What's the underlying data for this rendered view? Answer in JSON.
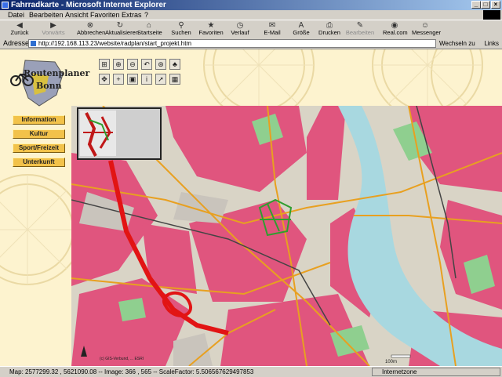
{
  "window": {
    "title": "Fahrradkarte - Microsoft Internet Explorer"
  },
  "menu": [
    "Datei",
    "Bearbeiten",
    "Ansicht",
    "Favoriten",
    "Extras",
    "?"
  ],
  "toolbar": [
    {
      "label": "Zurück",
      "icon": "back-arrow-icon",
      "enabled": true
    },
    {
      "label": "Vorwärts",
      "icon": "forward-arrow-icon",
      "enabled": false
    },
    {
      "label": "Abbrechen",
      "icon": "stop-icon",
      "enabled": true
    },
    {
      "label": "Aktualisieren",
      "icon": "refresh-icon",
      "enabled": true
    },
    {
      "label": "Startseite",
      "icon": "home-icon",
      "enabled": true
    },
    {
      "label": "Suchen",
      "icon": "search-icon",
      "enabled": true
    },
    {
      "label": "Favoriten",
      "icon": "favorites-icon",
      "enabled": true
    },
    {
      "label": "Verlauf",
      "icon": "history-icon",
      "enabled": true
    },
    {
      "label": "E-Mail",
      "icon": "mail-icon",
      "enabled": true
    },
    {
      "label": "Größe",
      "icon": "font-size-icon",
      "enabled": true
    },
    {
      "label": "Drucken",
      "icon": "print-icon",
      "enabled": true
    },
    {
      "label": "Bearbeiten",
      "icon": "edit-icon",
      "enabled": false
    },
    {
      "label": "Real.com",
      "icon": "real-icon",
      "enabled": true
    },
    {
      "label": "Messenger",
      "icon": "messenger-icon",
      "enabled": true
    }
  ],
  "address": {
    "label": "Adresse",
    "url": "http://192.168.113.23/website/radplan/start_projekt.htm",
    "go_label": "Wechseln zu",
    "links_label": "Links"
  },
  "logo": {
    "line1": "Routenplaner",
    "line2": "Bonn"
  },
  "sidebar": [
    {
      "label": "Information"
    },
    {
      "label": "Kultur"
    },
    {
      "label": "Sport/Freizeit"
    },
    {
      "label": "Unterkunft"
    }
  ],
  "map": {
    "scale_text": "100m",
    "credit": "(c) GIS-Verbund, ... ESRI"
  },
  "status": {
    "text": "Map: 2577299.32 , 5621090.08 -- Image: 366 , 565 -- ScaleFactor: 5.506567629497853",
    "zone": "Internetzone"
  },
  "colors": {
    "title_start": "#0a246a",
    "title_end": "#a6caf0",
    "page_bg": "#fdf3cf",
    "button_yellow": "#f2c24a",
    "map_urban": "#e0557e",
    "map_river": "#a8d8e0",
    "map_green": "#8fcf8f",
    "map_road": "#e8a020",
    "route_red": "#e21414",
    "route_green": "#2f9e2f"
  }
}
